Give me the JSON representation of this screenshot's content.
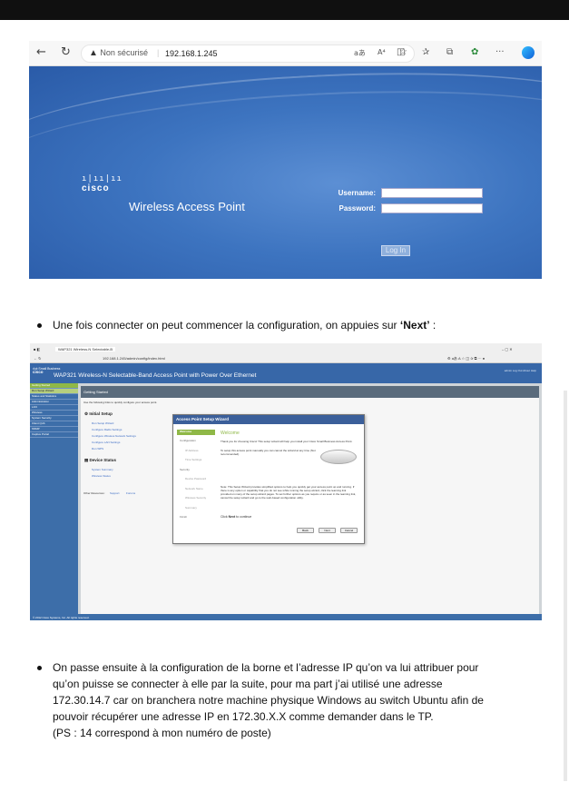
{
  "screenshot1": {
    "browser": {
      "security_label": "Non sécurisé",
      "address": "192.168.1.245",
      "reader_icon": "aあ",
      "aa_icon": "A⁴"
    },
    "login_page": {
      "brand": "cisco",
      "product": "Wireless Access Point",
      "username_label": "Username:",
      "password_label": "Password:",
      "login_button": "Log In"
    }
  },
  "paragraph1": {
    "before": "Une fois connecter on peut commencer la configuration, on appuies sur ",
    "bold": "‘Next’",
    "after": " :"
  },
  "screenshot2": {
    "browser": {
      "tab_label": "WAP321 Wireless-N Selectable-B",
      "address": "192.168.1.245/admin/config/index.html"
    },
    "header": {
      "brand_top": "ılıılı Small Business",
      "brand": "cisco",
      "title": "WAP321 Wireless-N Selectable-Band Access Point with Power Over Ethernet",
      "links": "admin   Log Out   About   Help"
    },
    "sidebar": [
      "Getting Started",
      "Run Setup Wizard",
      "Status and Statistics",
      "Administration",
      "LAN",
      "Wireless",
      "System Security",
      "Client QoS",
      "SNMP",
      "Captive Portal"
    ],
    "main": {
      "heading": "Getting Started",
      "intro": "Use the following links to quickly configure your access point.",
      "initial_setup": "Initial Setup",
      "initial_links": [
        "Run Setup Wizard",
        "Configure Radio Settings",
        "Configure Wireless Network Settings",
        "Configure LAN Settings",
        "Run WPS"
      ],
      "device_status": "Device Status",
      "status_links": [
        "System Summary",
        "Wireless Status"
      ],
      "other_resources": "Other Resources:",
      "other_links": [
        "Support",
        "Forums"
      ],
      "footer": "© 2012 Cisco Systems, Inc. All rights reserved."
    },
    "wizard": {
      "title": "Access Point Setup Wizard",
      "steps": [
        "Welcome",
        "Configuration",
        "IP Address",
        "Time Settings",
        "Security",
        "Device Password",
        "Network Name",
        "Wireless Security",
        "Summary",
        "Finish"
      ],
      "heading": "Welcome",
      "p1": "Thank you for choosing Cisco! This setup wizard will help you install your Cisco Small Business Access Point.",
      "p2": "To setup this access point manually you can cancel the wizard at any time (Not recommended).",
      "p3": "Note: This Setup Wizard provides simplified options to help you quickly get your access point up and running. If there is any option or capability that you do not see while running the setup wizard, click the learning link provided on many of the setup wizard pages. To set further options as you require or as seen in the learning link, cancel the setup wizard and go to the web-based configuration utility.",
      "p4_bold": "Next",
      "p4_before": "Click ",
      "p4_after": " to continue",
      "buttons": [
        "Back",
        "Next",
        "Cancel"
      ]
    }
  },
  "paragraph2": {
    "lines": [
      "On passe ensuite à la configuration de la borne et l’adresse IP qu’on va lui attribuer pour",
      "qu’on puisse se connecter à elle par la suite, pour ma part j’ai utilisé une adresse",
      "172.30.14.7 car on branchera notre machine physique Windows au switch Ubuntu afin de",
      "pouvoir récupérer une adresse IP en 172.30.X.X comme demander dans le TP.",
      "(PS : 14 correspond à mon numéro de poste)"
    ]
  }
}
